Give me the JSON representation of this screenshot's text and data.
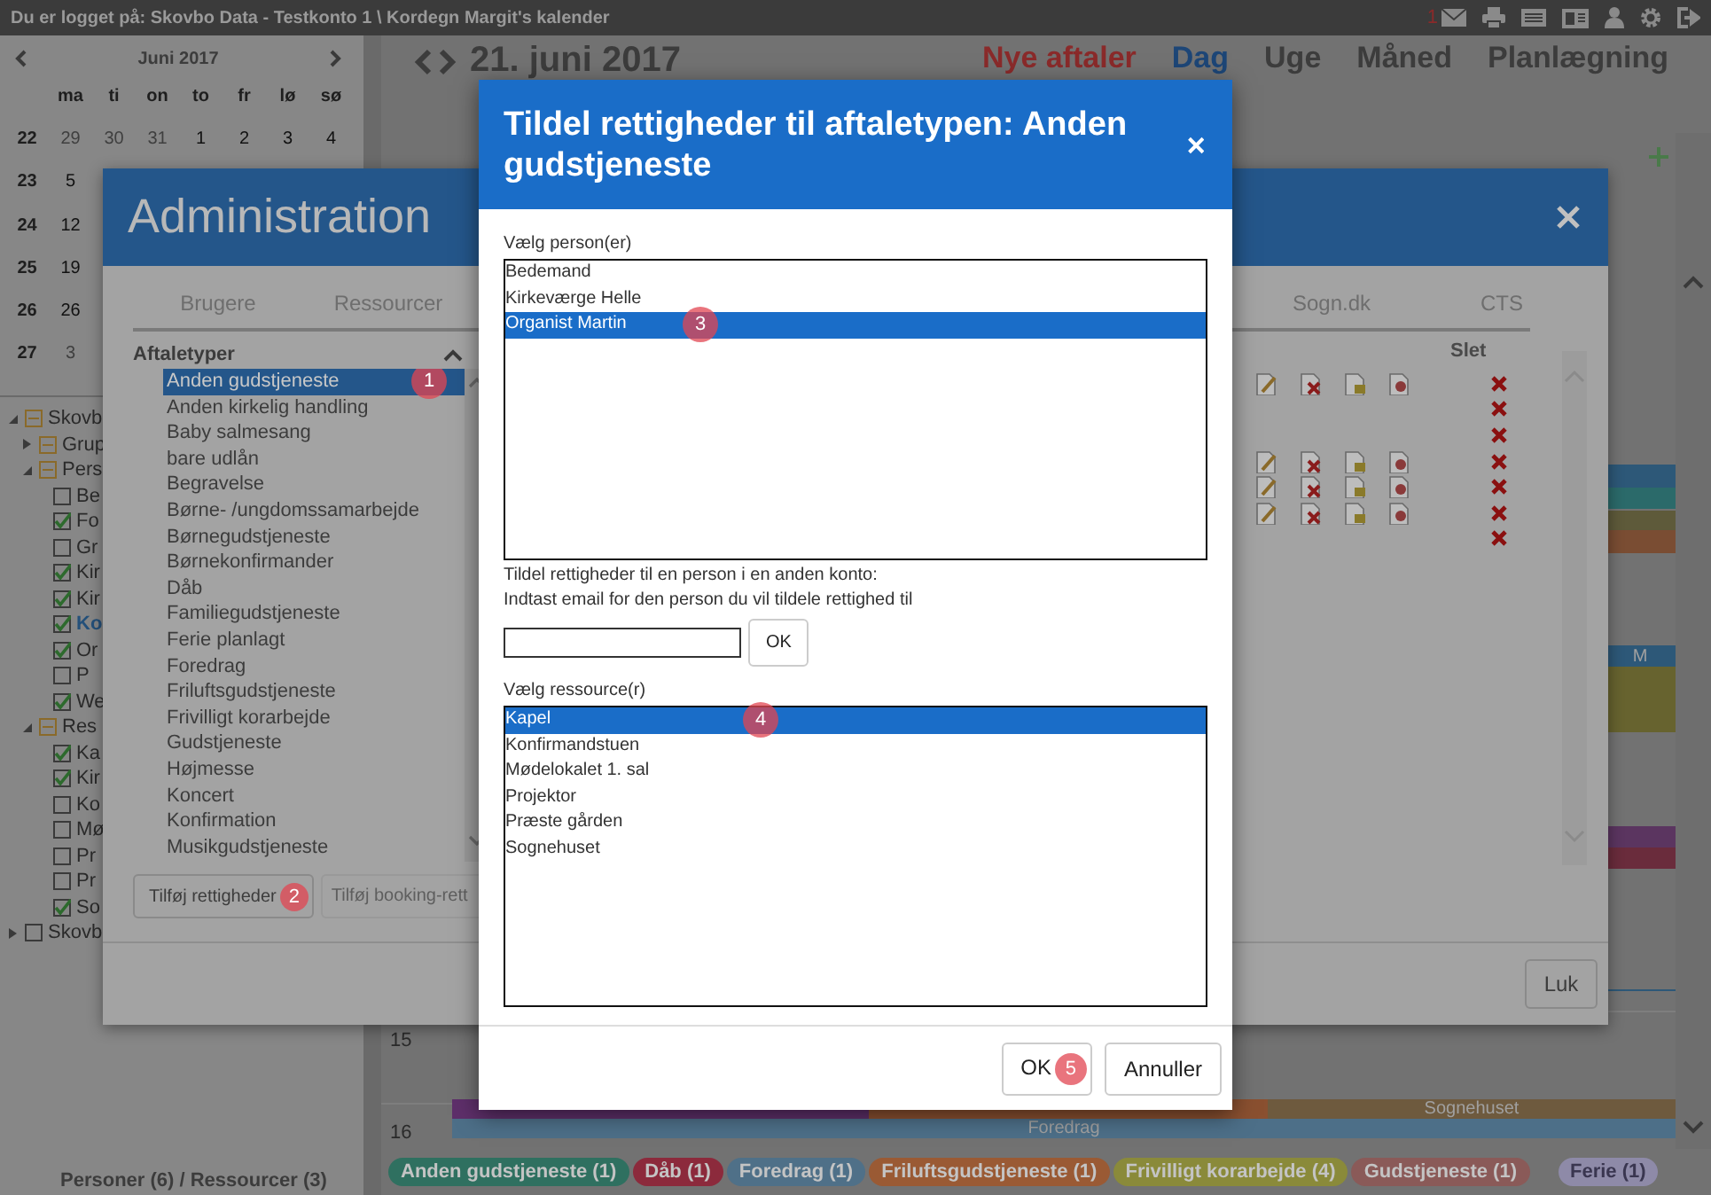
{
  "topbar": {
    "login_text": "Du er logget på: Skovbo Data - Testkonto 1 \\ Kordegn Margit's kalender",
    "message_count": "1"
  },
  "mini_calendar": {
    "month": "Juni 2017",
    "weekdays": [
      "ma",
      "ti",
      "on",
      "to",
      "fr",
      "lø",
      "sø"
    ],
    "weeks": [
      {
        "number": "22",
        "days": [
          {
            "day": "29",
            "other_month": true
          },
          {
            "day": "30",
            "other_month": true
          },
          {
            "day": "31",
            "other_month": true
          },
          {
            "day": "1",
            "other_month": false
          },
          {
            "day": "2",
            "other_month": false
          },
          {
            "day": "3",
            "other_month": false
          },
          {
            "day": "4",
            "other_month": false
          }
        ]
      },
      {
        "number": "23",
        "days": [
          {
            "day": "5",
            "other_month": false
          }
        ]
      },
      {
        "number": "24",
        "days": [
          {
            "day": "12",
            "other_month": false
          }
        ]
      },
      {
        "number": "25",
        "days": [
          {
            "day": "19",
            "other_month": false
          }
        ]
      },
      {
        "number": "26",
        "days": [
          {
            "day": "26",
            "other_month": false
          }
        ]
      },
      {
        "number": "27",
        "days": [
          {
            "day": "3",
            "other_month": true
          }
        ]
      }
    ]
  },
  "tree": [
    {
      "label": "Skovb",
      "kind": "group",
      "expanded": true,
      "children": [
        {
          "label": "Grup",
          "kind": "group",
          "expanded": false
        },
        {
          "label": "Pers",
          "kind": "group",
          "expanded": true,
          "children": [
            {
              "label": "Be",
              "kind": "item",
              "checked": false,
              "current": false
            },
            {
              "label": "Fo",
              "kind": "item",
              "checked": true,
              "current": false
            },
            {
              "label": "Gr",
              "kind": "item",
              "checked": false,
              "current": false
            },
            {
              "label": "Kir",
              "kind": "item",
              "checked": true,
              "current": false
            },
            {
              "label": "Kir",
              "kind": "item",
              "checked": true,
              "current": false
            },
            {
              "label": "Ko",
              "kind": "item",
              "checked": true,
              "current": true
            },
            {
              "label": "Or",
              "kind": "item",
              "checked": true,
              "current": false
            },
            {
              "label": "P",
              "kind": "item",
              "checked": false,
              "current": false
            },
            {
              "label": "We",
              "kind": "item",
              "checked": true,
              "current": false
            }
          ]
        },
        {
          "label": "Res",
          "kind": "group",
          "expanded": true,
          "children": [
            {
              "label": "Ka",
              "kind": "item",
              "checked": true,
              "current": false
            },
            {
              "label": "Kir",
              "kind": "item",
              "checked": true,
              "current": false
            },
            {
              "label": "Ko",
              "kind": "item",
              "checked": false,
              "current": false
            },
            {
              "label": "Mø",
              "kind": "item",
              "checked": false,
              "current": false
            },
            {
              "label": "Pr",
              "kind": "item",
              "checked": false,
              "current": false
            },
            {
              "label": "Pr",
              "kind": "item",
              "checked": false,
              "current": false
            },
            {
              "label": "So",
              "kind": "item",
              "checked": true,
              "current": false
            }
          ]
        }
      ]
    },
    {
      "label": "Skovb",
      "kind": "item",
      "expanded": false,
      "checked": false,
      "current": false
    }
  ],
  "tree_footer": "Personer (6) / Ressourcer (3)",
  "calendar": {
    "date": "21. juni 2017",
    "views": [
      {
        "label": "Nye aftaler",
        "kind": "new",
        "selected": false
      },
      {
        "label": "Dag",
        "kind": "view",
        "selected": true
      },
      {
        "label": "Uge",
        "kind": "view",
        "selected": false
      },
      {
        "label": "Måned",
        "kind": "view",
        "selected": false
      },
      {
        "label": "Planlægning",
        "kind": "view",
        "selected": false
      }
    ],
    "hours": [
      "15",
      "16"
    ],
    "events": [
      {
        "color": "#2d5878"
      },
      {
        "color": "#2b6a6a"
      },
      {
        "color": "#5e5a3a"
      },
      {
        "color": "#7a4d33"
      },
      {
        "color": "#2d5878",
        "label": "M"
      },
      {
        "color": "#67632f"
      },
      {
        "color": "#5b3560"
      },
      {
        "color": "#6a2c3c"
      },
      {
        "color": "#5e2f6a"
      },
      {
        "color": "#8a5030"
      },
      {
        "color": "#6e5a3e",
        "label": "Sognehuset"
      },
      {
        "color": "#4d6f88",
        "label": "Foredrag"
      }
    ],
    "legend": [
      {
        "label": "Anden gudstjeneste (1)",
        "color": "#2f7060"
      },
      {
        "label": "Dåb (1)",
        "color": "#8c2a3c"
      },
      {
        "label": "Foredrag (1)",
        "color": "#4f7088"
      },
      {
        "label": "Friluftsgudstjeneste (1)",
        "color": "#9a5a34"
      },
      {
        "label": "Frivilligt korarbejde (4)",
        "color": "#8a8a3a"
      },
      {
        "label": "Gudstjeneste (1)",
        "color": "#8a5a58"
      },
      {
        "label": "Ferie (1)",
        "color": "#8e8aa8"
      }
    ]
  },
  "admin": {
    "title": "Administration",
    "tabs_left": [
      "Brugere",
      "Ressourcer"
    ],
    "tabs_right": [
      "Sogn.dk",
      "CTS"
    ],
    "list_title": "Aftaletyper",
    "items": [
      {
        "label": "Anden gudstjeneste",
        "selected": true,
        "marker": "1"
      },
      {
        "label": "Anden kirkelig handling",
        "selected": false
      },
      {
        "label": "Baby salmesang",
        "selected": false
      },
      {
        "label": "bare udlån",
        "selected": false
      },
      {
        "label": "Begravelse",
        "selected": false
      },
      {
        "label": "Børne- /ungdomssamarbejde",
        "selected": false
      },
      {
        "label": "Børnegudstjeneste",
        "selected": false
      },
      {
        "label": "Børnekonfirmander",
        "selected": false
      },
      {
        "label": "Dåb",
        "selected": false
      },
      {
        "label": "Familiegudstjeneste",
        "selected": false
      },
      {
        "label": "Ferie planlagt",
        "selected": false
      },
      {
        "label": "Foredrag",
        "selected": false
      },
      {
        "label": "Friluftsgudstjeneste",
        "selected": false
      },
      {
        "label": "Frivilligt korarbejde",
        "selected": false
      },
      {
        "label": "Gudstjeneste",
        "selected": false
      },
      {
        "label": "Højmesse",
        "selected": false
      },
      {
        "label": "Koncert",
        "selected": false
      },
      {
        "label": "Konfirmation",
        "selected": false
      },
      {
        "label": "Musikgudstjeneste",
        "selected": false
      }
    ],
    "buttons": [
      {
        "label": "Tilføj rettigheder",
        "disabled": false,
        "marker": "2"
      },
      {
        "label": "Tilføj booking-rett",
        "disabled": true
      }
    ],
    "delete_header": "Slet",
    "rows": [
      {
        "has_permissions": true
      },
      {
        "has_permissions": false
      },
      {
        "has_permissions": false
      },
      {
        "has_permissions": true
      },
      {
        "has_permissions": true
      },
      {
        "has_permissions": true
      },
      {
        "has_permissions": false
      }
    ],
    "close_label": "Luk"
  },
  "dialog": {
    "title": "Tildel rettigheder til aftaletypen: Anden gudstjeneste",
    "person_label": "Vælg person(er)",
    "persons": [
      {
        "label": "Bedemand",
        "selected": false
      },
      {
        "label": "Kirkeværge Helle",
        "selected": false
      },
      {
        "label": "Organist Martin",
        "selected": true,
        "marker": "3"
      }
    ],
    "other_account_text": "Tildel rettigheder til en person i en anden konto:",
    "email_hint": "Indtast email for den person du vil tildele rettighed til",
    "email_button": "OK",
    "resource_label": "Vælg ressource(r)",
    "resources": [
      {
        "label": "Kapel",
        "selected": true,
        "marker": "4"
      },
      {
        "label": "Konfirmandstuen",
        "selected": false
      },
      {
        "label": "Mødelokalet 1. sal",
        "selected": false
      },
      {
        "label": "Projektor",
        "selected": false
      },
      {
        "label": "Præste gården",
        "selected": false
      },
      {
        "label": "Sognehuset",
        "selected": false
      }
    ],
    "buttons": [
      {
        "label": "OK",
        "marker": "5"
      },
      {
        "label": "Annuller"
      }
    ]
  }
}
